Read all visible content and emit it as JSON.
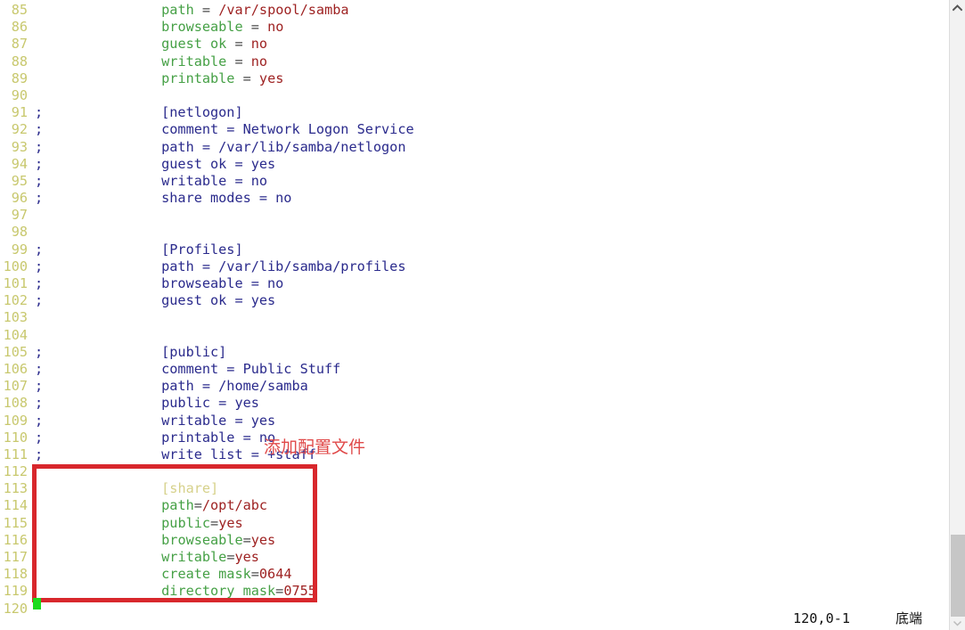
{
  "app": {
    "kind": "terminal-text-editor",
    "file_type": "samba-smb-conf"
  },
  "colors": {
    "background": "#ffffff",
    "line_number": "#c8c86e",
    "comment": "#2a2a8c",
    "key": "#45a045",
    "value": "#9e2222",
    "equals": "#4a4a4a",
    "section": "#d6d18a",
    "annotation_red": "#d8272c",
    "annotation_text_red": "#e04a4a",
    "cursor_green": "#1ddb1d",
    "scrollbar_track": "#f2f2f2",
    "scrollbar_thumb": "#c6c6c6"
  },
  "lines": [
    {
      "no": "85",
      "mark": "",
      "commented": false,
      "tokens": [
        {
          "t": "plain",
          "s": "        "
        },
        {
          "t": "key",
          "s": "path"
        },
        {
          "t": "plain",
          "s": " "
        },
        {
          "t": "eq",
          "s": "="
        },
        {
          "t": "plain",
          "s": " "
        },
        {
          "t": "val",
          "s": "/var/spool/samba"
        }
      ]
    },
    {
      "no": "86",
      "mark": "",
      "commented": false,
      "tokens": [
        {
          "t": "plain",
          "s": "        "
        },
        {
          "t": "key",
          "s": "browseable"
        },
        {
          "t": "plain",
          "s": " "
        },
        {
          "t": "eq",
          "s": "="
        },
        {
          "t": "plain",
          "s": " "
        },
        {
          "t": "val",
          "s": "no"
        }
      ]
    },
    {
      "no": "87",
      "mark": "",
      "commented": false,
      "tokens": [
        {
          "t": "plain",
          "s": "        "
        },
        {
          "t": "key",
          "s": "guest ok"
        },
        {
          "t": "plain",
          "s": " "
        },
        {
          "t": "eq",
          "s": "="
        },
        {
          "t": "plain",
          "s": " "
        },
        {
          "t": "val",
          "s": "no"
        }
      ]
    },
    {
      "no": "88",
      "mark": "",
      "commented": false,
      "tokens": [
        {
          "t": "plain",
          "s": "        "
        },
        {
          "t": "key",
          "s": "writable"
        },
        {
          "t": "plain",
          "s": " "
        },
        {
          "t": "eq",
          "s": "="
        },
        {
          "t": "plain",
          "s": " "
        },
        {
          "t": "val",
          "s": "no"
        }
      ]
    },
    {
      "no": "89",
      "mark": "",
      "commented": false,
      "tokens": [
        {
          "t": "plain",
          "s": "        "
        },
        {
          "t": "key",
          "s": "printable"
        },
        {
          "t": "plain",
          "s": " "
        },
        {
          "t": "eq",
          "s": "="
        },
        {
          "t": "plain",
          "s": " "
        },
        {
          "t": "val",
          "s": "yes"
        }
      ]
    },
    {
      "no": "90",
      "mark": "",
      "commented": false,
      "tokens": []
    },
    {
      "no": "91",
      "mark": ";",
      "commented": true,
      "text": "        [netlogon]"
    },
    {
      "no": "92",
      "mark": ";",
      "commented": true,
      "text": "        comment = Network Logon Service"
    },
    {
      "no": "93",
      "mark": ";",
      "commented": true,
      "text": "        path = /var/lib/samba/netlogon"
    },
    {
      "no": "94",
      "mark": ";",
      "commented": true,
      "text": "        guest ok = yes"
    },
    {
      "no": "95",
      "mark": ";",
      "commented": true,
      "text": "        writable = no"
    },
    {
      "no": "96",
      "mark": ";",
      "commented": true,
      "text": "        share modes = no"
    },
    {
      "no": "97",
      "mark": "",
      "commented": true,
      "text": ""
    },
    {
      "no": "98",
      "mark": "",
      "commented": true,
      "text": ""
    },
    {
      "no": "99",
      "mark": ";",
      "commented": true,
      "text": "        [Profiles]"
    },
    {
      "no": "100",
      "mark": ";",
      "commented": true,
      "text": "        path = /var/lib/samba/profiles"
    },
    {
      "no": "101",
      "mark": ";",
      "commented": true,
      "text": "        browseable = no"
    },
    {
      "no": "102",
      "mark": ";",
      "commented": true,
      "text": "        guest ok = yes"
    },
    {
      "no": "103",
      "mark": "",
      "commented": true,
      "text": ""
    },
    {
      "no": "104",
      "mark": "",
      "commented": true,
      "text": ""
    },
    {
      "no": "105",
      "mark": ";",
      "commented": true,
      "text": "        [public]"
    },
    {
      "no": "106",
      "mark": ";",
      "commented": true,
      "text": "        comment = Public Stuff"
    },
    {
      "no": "107",
      "mark": ";",
      "commented": true,
      "text": "        path = /home/samba"
    },
    {
      "no": "108",
      "mark": ";",
      "commented": true,
      "text": "        public = yes"
    },
    {
      "no": "109",
      "mark": ";",
      "commented": true,
      "text": "        writable = yes"
    },
    {
      "no": "110",
      "mark": ";",
      "commented": true,
      "text": "        printable = no"
    },
    {
      "no": "111",
      "mark": ";",
      "commented": true,
      "text": "        write list = +staff"
    },
    {
      "no": "112",
      "mark": "",
      "commented": false,
      "tokens": []
    },
    {
      "no": "113",
      "mark": "",
      "commented": false,
      "tokens": [
        {
          "t": "plain",
          "s": "        "
        },
        {
          "t": "sect",
          "s": "[share]"
        }
      ]
    },
    {
      "no": "114",
      "mark": "",
      "commented": false,
      "tokens": [
        {
          "t": "plain",
          "s": "        "
        },
        {
          "t": "key",
          "s": "path"
        },
        {
          "t": "eq",
          "s": "="
        },
        {
          "t": "val",
          "s": "/opt/abc"
        }
      ]
    },
    {
      "no": "115",
      "mark": "",
      "commented": false,
      "tokens": [
        {
          "t": "plain",
          "s": "        "
        },
        {
          "t": "key",
          "s": "public"
        },
        {
          "t": "eq",
          "s": "="
        },
        {
          "t": "val",
          "s": "yes"
        }
      ]
    },
    {
      "no": "116",
      "mark": "",
      "commented": false,
      "tokens": [
        {
          "t": "plain",
          "s": "        "
        },
        {
          "t": "key",
          "s": "browseable"
        },
        {
          "t": "eq",
          "s": "="
        },
        {
          "t": "val",
          "s": "yes"
        }
      ]
    },
    {
      "no": "117",
      "mark": "",
      "commented": false,
      "tokens": [
        {
          "t": "plain",
          "s": "        "
        },
        {
          "t": "key",
          "s": "writable"
        },
        {
          "t": "eq",
          "s": "="
        },
        {
          "t": "val",
          "s": "yes"
        }
      ]
    },
    {
      "no": "118",
      "mark": "",
      "commented": false,
      "tokens": [
        {
          "t": "plain",
          "s": "        "
        },
        {
          "t": "key",
          "s": "create mask"
        },
        {
          "t": "eq",
          "s": "="
        },
        {
          "t": "val",
          "s": "0644"
        }
      ]
    },
    {
      "no": "119",
      "mark": "",
      "commented": false,
      "tokens": [
        {
          "t": "plain",
          "s": "        "
        },
        {
          "t": "key",
          "s": "directory mask"
        },
        {
          "t": "eq",
          "s": "="
        },
        {
          "t": "val",
          "s": "0755"
        }
      ]
    },
    {
      "no": "120",
      "mark": "",
      "commented": false,
      "tokens": []
    }
  ],
  "annotation": {
    "label": "添加配置文件",
    "box_color": "#d8272c"
  },
  "statusbar": {
    "position": "120,0-1",
    "location": "底端"
  },
  "scrollbar": {
    "up_arrow": "chevron-up-icon",
    "down_arrow": "chevron-down-icon"
  }
}
